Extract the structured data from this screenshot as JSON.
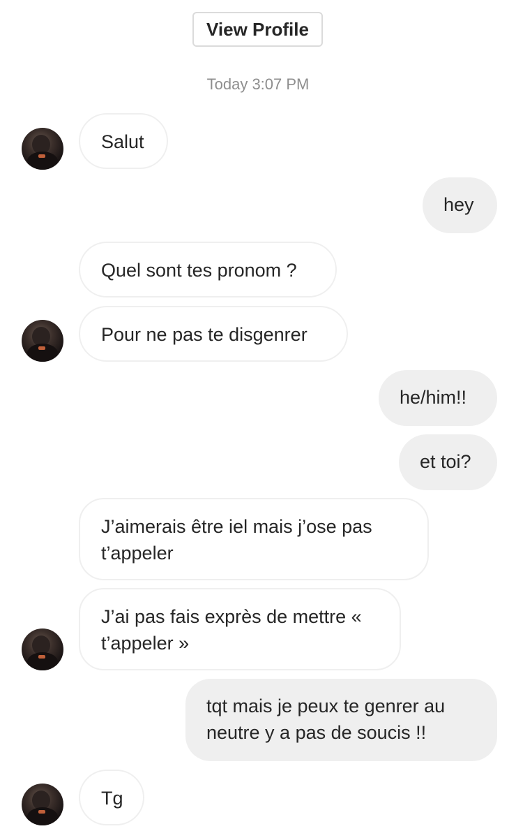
{
  "header": {
    "view_profile_label": "View Profile",
    "timestamp": "Today 3:07 PM"
  },
  "messages": [
    {
      "from": "them",
      "text": "Salut"
    },
    {
      "from": "me",
      "text": "hey"
    },
    {
      "from": "them",
      "text": "Quel sont tes pronom ?"
    },
    {
      "from": "them",
      "text": "Pour ne pas te disgenrer"
    },
    {
      "from": "me",
      "text": "he/him!!"
    },
    {
      "from": "me",
      "text": "et toi?"
    },
    {
      "from": "them",
      "text": "J’aimerais être iel mais j’ose pas t’appeler"
    },
    {
      "from": "them",
      "text": "J’ai pas fais exprès de mettre « t’appeler »"
    },
    {
      "from": "me",
      "text": "tqt mais je peux te genrer au neutre y a pas de soucis !!"
    },
    {
      "from": "them",
      "text": "Tg"
    }
  ],
  "icons": {
    "avatar": "profile-photo-avatar"
  }
}
